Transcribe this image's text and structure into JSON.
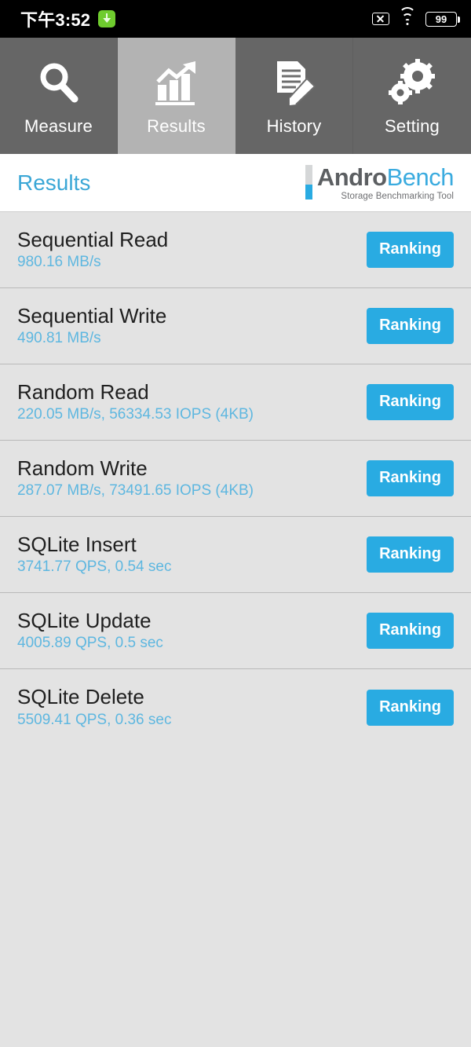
{
  "status_bar": {
    "time": "下午3:52",
    "download_icon": "download-icon",
    "icons": [
      "close-box-icon",
      "wifi-icon",
      "battery-icon"
    ],
    "battery_level": "99"
  },
  "tabs": [
    {
      "label": "Measure",
      "icon": "magnifier-icon",
      "active": false
    },
    {
      "label": "Results",
      "icon": "bar-chart-arrow-icon",
      "active": true
    },
    {
      "label": "History",
      "icon": "document-pencil-icon",
      "active": false
    },
    {
      "label": "Setting",
      "icon": "gears-icon",
      "active": false
    }
  ],
  "header": {
    "title": "Results",
    "brand_primary": "Andro",
    "brand_secondary": "Bench",
    "brand_tagline": "Storage Benchmarking Tool"
  },
  "colors": {
    "accent_blue": "#29abe2",
    "value_blue": "#5eb7e0",
    "title_blue": "#3ba7d6",
    "list_bg": "#e3e3e3",
    "tab_inactive": "#666666",
    "tab_active": "#b3b3b3",
    "brand_gray": "#5c5f62"
  },
  "results": [
    {
      "name": "Sequential Read",
      "value": "980.16 MB/s",
      "button": "Ranking"
    },
    {
      "name": "Sequential Write",
      "value": "490.81 MB/s",
      "button": "Ranking"
    },
    {
      "name": "Random Read",
      "value": "220.05 MB/s, 56334.53 IOPS (4KB)",
      "button": "Ranking"
    },
    {
      "name": "Random Write",
      "value": "287.07 MB/s, 73491.65 IOPS (4KB)",
      "button": "Ranking"
    },
    {
      "name": "SQLite Insert",
      "value": "3741.77 QPS, 0.54 sec",
      "button": "Ranking"
    },
    {
      "name": "SQLite Update",
      "value": "4005.89 QPS, 0.5 sec",
      "button": "Ranking"
    },
    {
      "name": "SQLite Delete",
      "value": "5509.41 QPS, 0.36 sec",
      "button": "Ranking"
    }
  ]
}
